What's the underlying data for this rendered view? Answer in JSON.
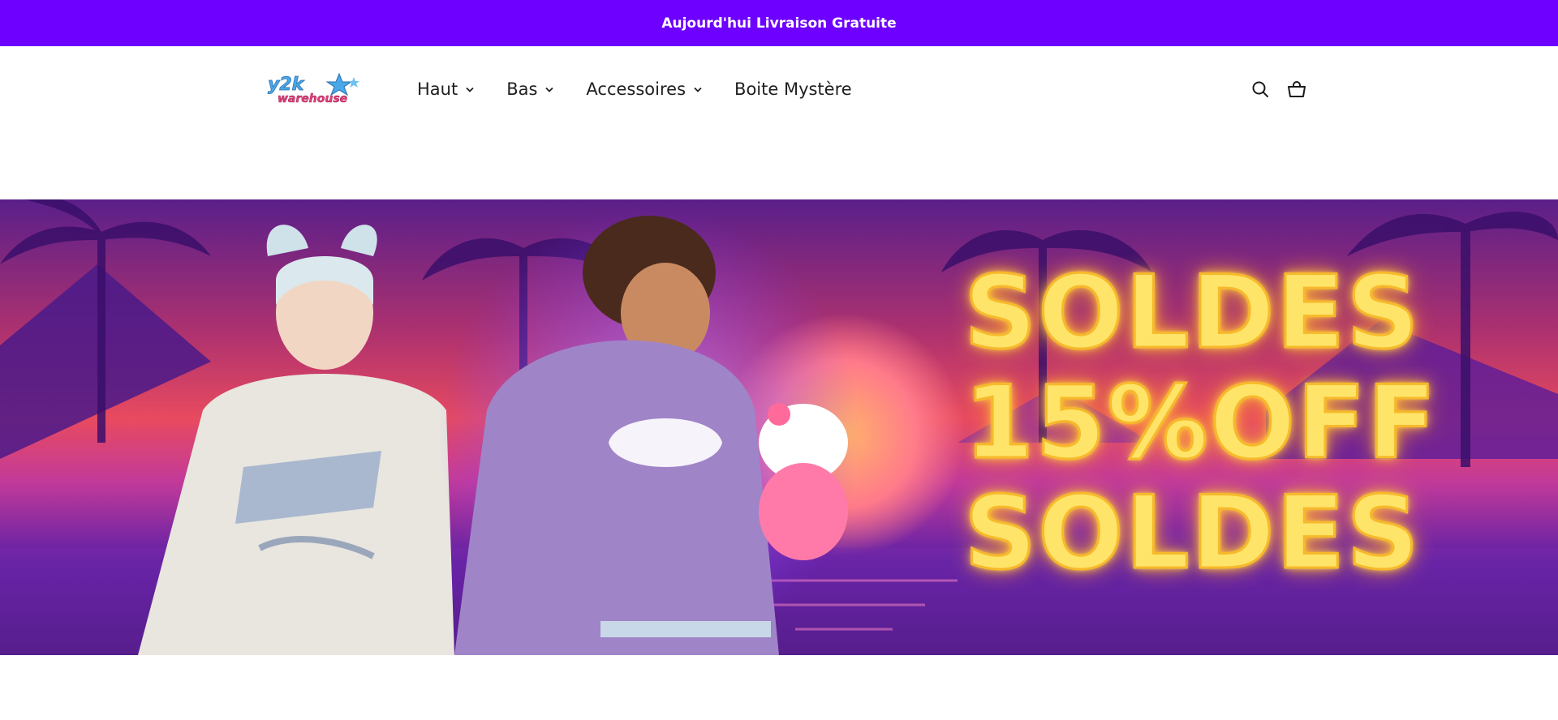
{
  "announcement": {
    "text": "Aujourd'hui Livraison Gratuite"
  },
  "header": {
    "logo_alt": "y2k warehouse",
    "nav": [
      {
        "label": "Haut",
        "has_dropdown": true
      },
      {
        "label": "Bas",
        "has_dropdown": true
      },
      {
        "label": "Accessoires",
        "has_dropdown": true
      },
      {
        "label": "Boite Mystère",
        "has_dropdown": false
      }
    ],
    "icons": {
      "search": "search-icon",
      "cart": "cart-icon"
    }
  },
  "hero": {
    "promo_lines": [
      "SOLDES",
      "15%OFF",
      "SOLDES"
    ]
  },
  "colors": {
    "announcement_bg": "#6e00ff",
    "promo_text": "#ffe46a",
    "logo_blue": "#4aa8e8",
    "logo_pink": "#e0407a"
  }
}
